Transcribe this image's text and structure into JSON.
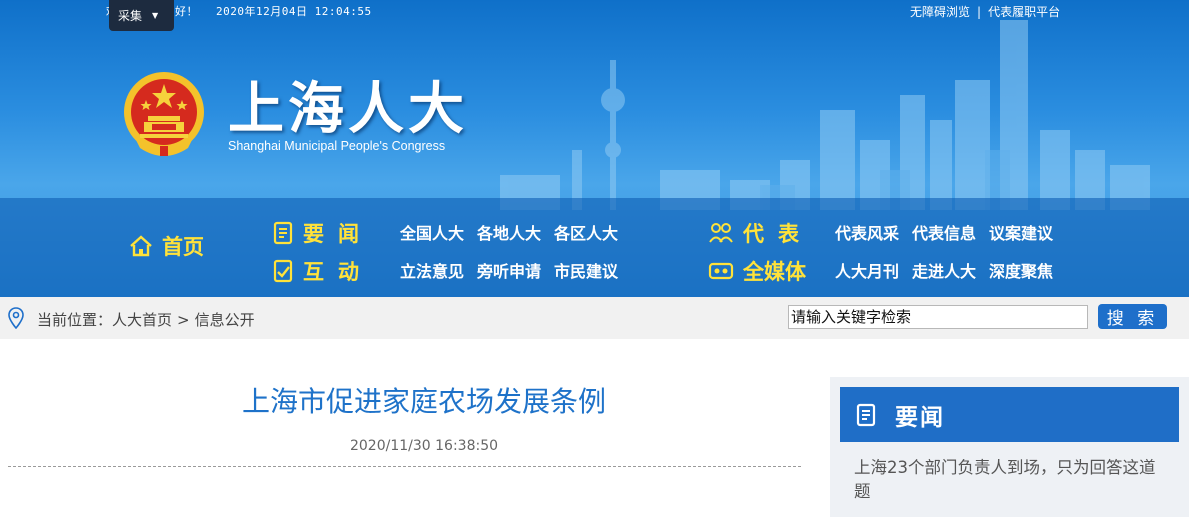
{
  "topbar": {
    "greeting": "欢迎您，下午好！",
    "date": "2020年12月04日 12:04:55",
    "links": [
      "无障碍浏览",
      "代表履职平台"
    ],
    "separator": "|",
    "collect_label": "采集",
    "collect_caret": "▼"
  },
  "site": {
    "title": "上海人大",
    "subtitle": "Shanghai Municipal People's Congress"
  },
  "nav": {
    "home": "首页",
    "news": {
      "label": "要闻",
      "links": [
        "全国人大",
        "各地人大",
        "各区人大"
      ]
    },
    "interact": {
      "label": "互动",
      "links": [
        "立法意见",
        "旁听申请",
        "市民建议"
      ]
    },
    "rep": {
      "label": "代表",
      "links": [
        "代表风采",
        "代表信息",
        "议案建议"
      ]
    },
    "media": {
      "label": "全媒体",
      "links": [
        "人大月刊",
        "走进人大",
        "深度聚焦"
      ]
    }
  },
  "location": {
    "prefix": "当前位置：",
    "crumbs": [
      "人大首页",
      "信息公开"
    ],
    "separator": ">"
  },
  "search": {
    "placeholder": "请输入关键字检索",
    "button": "搜 索"
  },
  "article": {
    "title": "上海市促进家庭农场发展条例",
    "date": "2020/11/30 16:38:50"
  },
  "sidebar": {
    "title": "要闻",
    "items": [
      "上海23个部门负责人到场，只为回答这道题"
    ]
  },
  "colors": {
    "header_blue": "#2b8ee0",
    "nav_yellow": "#ffe23a",
    "title_blue": "#1e72c9",
    "button_blue": "#1e6fca"
  }
}
